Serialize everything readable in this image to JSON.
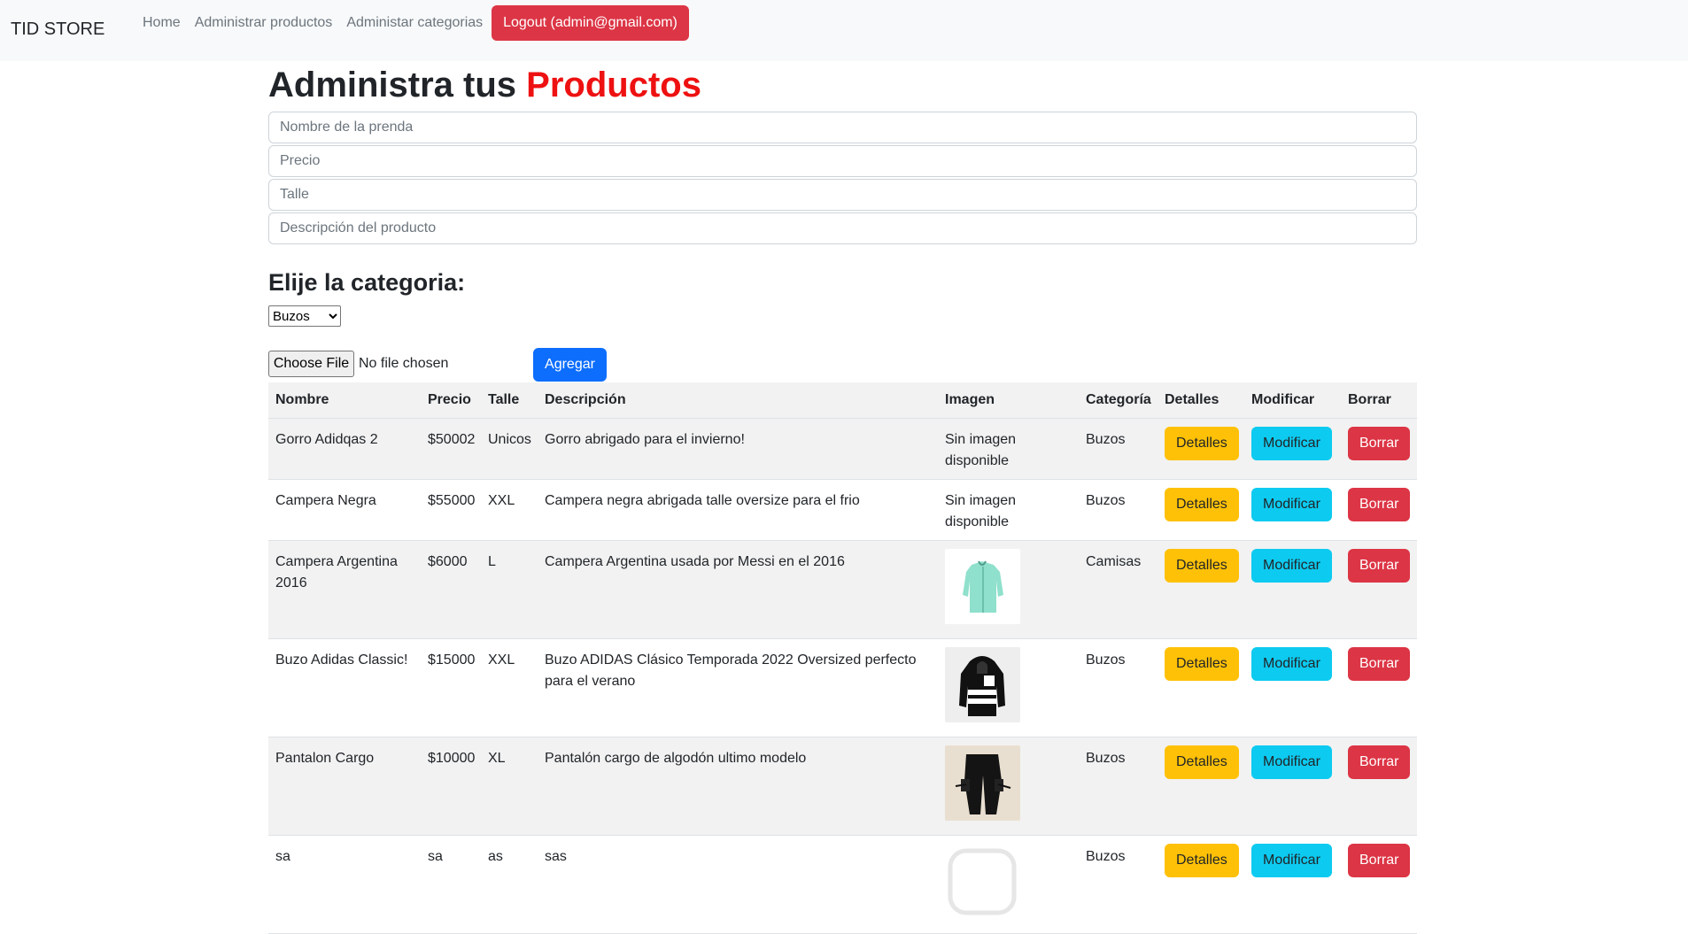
{
  "nav": {
    "brand": "TID STORE",
    "links": [
      "Home",
      "Administrar productos",
      "Administar categorias"
    ],
    "logout": "Logout (admin@gmail.com)"
  },
  "page": {
    "title_prefix": "Administra tus",
    "title_accent": "Productos"
  },
  "form": {
    "name_placeholder": "Nombre de la prenda",
    "price_placeholder": "Precio",
    "size_placeholder": "Talle",
    "description_placeholder": "Descripción del producto",
    "category_heading": "Elije la categoria:",
    "category_selected": "Buzos",
    "file_button": "Choose File",
    "file_status": "No file chosen",
    "add_button": "Agregar"
  },
  "table": {
    "headers": [
      "Nombre",
      "Precio",
      "Talle",
      "Descripción",
      "Imagen",
      "Categoría",
      "Detalles",
      "Modificar",
      "Borrar"
    ],
    "button_labels": {
      "details": "Detalles",
      "modify": "Modificar",
      "delete": "Borrar"
    },
    "no_image_text": "Sin imagen disponible",
    "rows": [
      {
        "name": "Gorro Adidqas 2",
        "price": "$50002",
        "size": "Unicos",
        "description": "Gorro abrigado para el invierno!",
        "image": "none",
        "category": "Buzos"
      },
      {
        "name": "Campera Negra",
        "price": "$55000",
        "size": "XXL",
        "description": "Campera negra abrigada talle oversize para el frio",
        "image": "none",
        "category": "Buzos"
      },
      {
        "name": "Campera Argentina 2016",
        "price": "$6000",
        "size": "L",
        "description": "Campera Argentina usada por Messi en el 2016",
        "image": "mint-jacket-thumbnail",
        "category": "Camisas"
      },
      {
        "name": "Buzo Adidas Classic!",
        "price": "$15000",
        "size": "XXL",
        "description": "Buzo ADIDAS Clásico Temporada 2022 Oversized perfecto para el verano",
        "image": "black-hoodie-thumbnail",
        "category": "Buzos"
      },
      {
        "name": "Pantalon Cargo",
        "price": "$10000",
        "size": "XL",
        "description": "Pantalón cargo de algodón ultimo modelo",
        "image": "black-cargo-pants-thumbnail",
        "category": "Buzos"
      },
      {
        "name": "sa",
        "price": "sa",
        "size": "as",
        "description": "sas",
        "image": "placeholder-image-thumbnail",
        "category": "Buzos"
      }
    ]
  },
  "colors": {
    "accent_red": "#ee1111",
    "danger": "#dc3545",
    "warning": "#ffc107",
    "info": "#0dcaf0",
    "primary": "#0d6efd"
  }
}
